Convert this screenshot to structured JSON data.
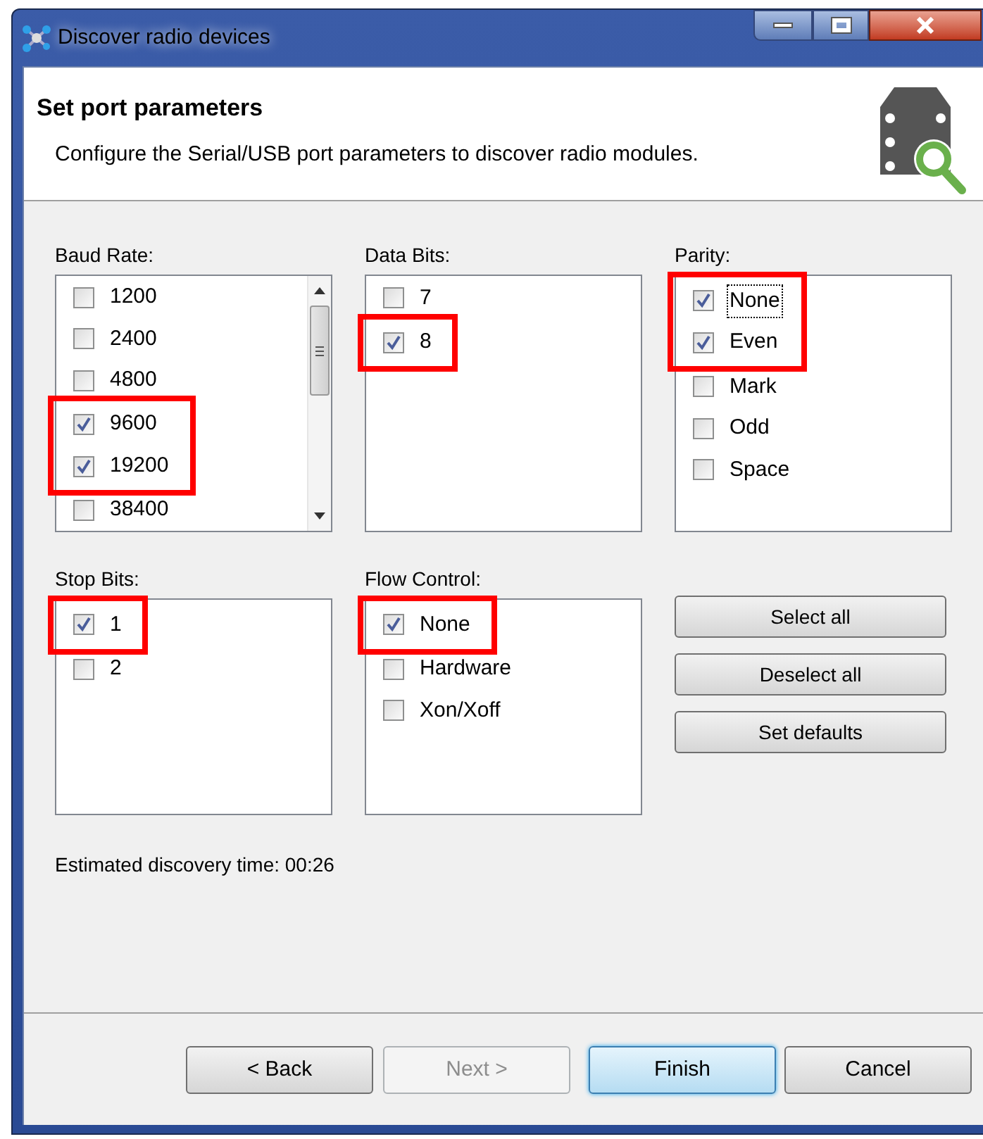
{
  "window": {
    "title": "Discover radio devices"
  },
  "header": {
    "title": "Set port parameters",
    "description": "Configure the Serial/USB port parameters to discover radio modules."
  },
  "groups": [
    {
      "label": "Baud Rate:",
      "scrollable": true,
      "items": [
        {
          "label": "1200",
          "checked": false,
          "highlighted": false
        },
        {
          "label": "2400",
          "checked": false,
          "highlighted": false
        },
        {
          "label": "4800",
          "checked": false,
          "highlighted": false
        },
        {
          "label": "9600",
          "checked": true,
          "highlighted": true
        },
        {
          "label": "19200",
          "checked": true,
          "highlighted": true
        },
        {
          "label": "38400",
          "checked": false,
          "highlighted": false
        }
      ]
    },
    {
      "label": "Data Bits:",
      "scrollable": false,
      "items": [
        {
          "label": "7",
          "checked": false,
          "highlighted": false
        },
        {
          "label": "8",
          "checked": true,
          "highlighted": true
        }
      ]
    },
    {
      "label": "Parity:",
      "scrollable": false,
      "items": [
        {
          "label": "None",
          "checked": true,
          "highlighted": true,
          "focused": true
        },
        {
          "label": "Even",
          "checked": true,
          "highlighted": true,
          "focused": false
        },
        {
          "label": "Mark",
          "checked": false,
          "highlighted": false,
          "focused": false
        },
        {
          "label": "Odd",
          "checked": false,
          "highlighted": false,
          "focused": false
        },
        {
          "label": "Space",
          "checked": false,
          "highlighted": false,
          "focused": false
        }
      ]
    },
    {
      "label": "Stop Bits:",
      "scrollable": false,
      "items": [
        {
          "label": "1",
          "checked": true,
          "highlighted": true
        },
        {
          "label": "2",
          "checked": false,
          "highlighted": false
        }
      ]
    },
    {
      "label": "Flow Control:",
      "scrollable": false,
      "items": [
        {
          "label": "None",
          "checked": true,
          "highlighted": true
        },
        {
          "label": "Hardware",
          "checked": false,
          "highlighted": false
        },
        {
          "label": "Xon/Xoff",
          "checked": false,
          "highlighted": false
        }
      ]
    }
  ],
  "side_buttons": [
    "Select all",
    "Deselect all",
    "Set defaults"
  ],
  "estimate": "Estimated discovery time: 00:26",
  "footer_buttons": [
    {
      "label": "< Back",
      "disabled": false,
      "focused": false
    },
    {
      "label": "Next >",
      "disabled": true,
      "focused": false
    },
    {
      "label": "Finish",
      "disabled": false,
      "focused": true
    },
    {
      "label": "Cancel",
      "disabled": false,
      "focused": false
    }
  ]
}
